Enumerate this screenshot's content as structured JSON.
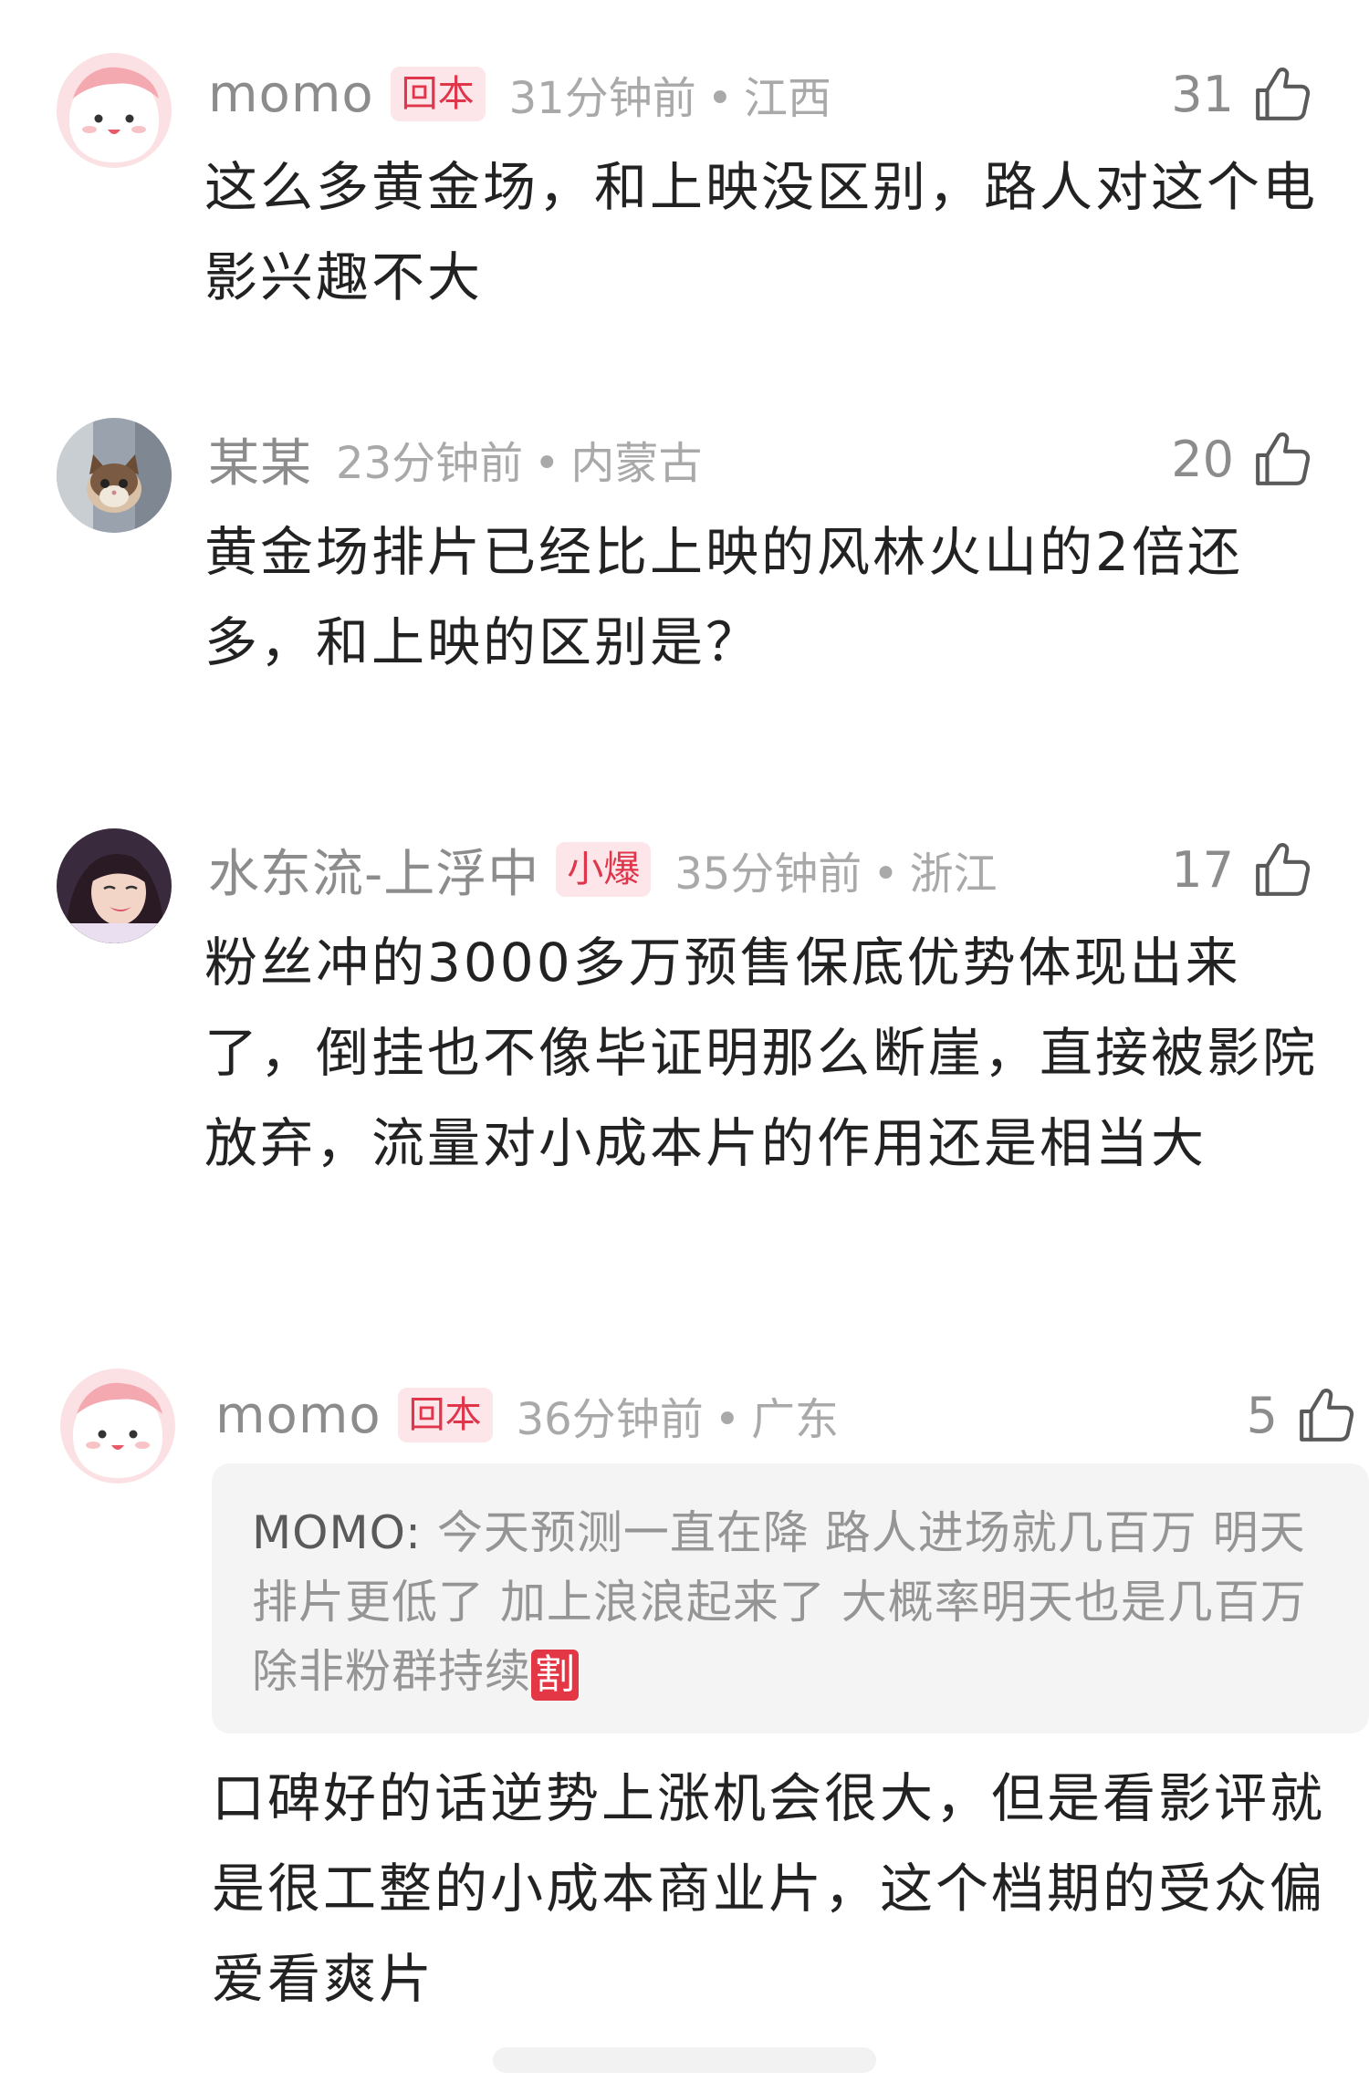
{
  "comments": [
    {
      "username": "momo",
      "badge": "回本",
      "time": "31分钟前",
      "separator": "•",
      "location": "江西",
      "likes": "31",
      "text": "这么多黄金场，和上映没区别，路人对这个电影兴趣不大",
      "avatar_icon": "pink-blob-avatar"
    },
    {
      "username": "某某",
      "time": "23分钟前",
      "separator": "•",
      "location": "内蒙古",
      "likes": "20",
      "text": "黄金场排片已经比上映的风林火山的2倍还多，和上映的区别是？",
      "avatar_icon": "kitten-avatar"
    },
    {
      "username": "水东流-上浮中",
      "badge": "小爆",
      "time": "35分钟前",
      "separator": "•",
      "location": "浙江",
      "likes": "17",
      "text": "粉丝冲的3000多万预售保底优势体现出来了，倒挂也不像毕证明那么断崖，直接被影院放弃，流量对小成本片的作用还是相当大",
      "avatar_icon": "woman-portrait-avatar"
    },
    {
      "username": "momo",
      "badge": "回本",
      "time": "36分钟前",
      "separator": "•",
      "location": "广东",
      "likes": "5",
      "quote": {
        "author": "MOMO:",
        "text": " 今天预测一直在降 路人进场就几百万 明天排片更低了 加上浪浪起来了 大概率明天也是几百万 除非粉群持续",
        "tag": "割"
      },
      "text": "口碑好的话逆势上涨机会很大，但是看影评就是很工整的小成本商业片，这个档期的受众偏爱看爽片",
      "avatar_icon": "pink-blob-avatar"
    }
  ],
  "colors": {
    "badge_text": "#e0364c",
    "badge_bg": "#fde6e9",
    "meta_text": "#a9a9a9",
    "body_text": "#222222",
    "quote_bg": "#f4f4f4",
    "cut_tag_bg": "#e33746"
  }
}
